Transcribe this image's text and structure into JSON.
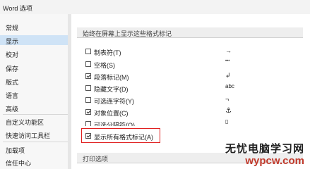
{
  "window": {
    "title": "Word 选项"
  },
  "sidebar": {
    "items": [
      {
        "label": "常规",
        "active": false
      },
      {
        "label": "显示",
        "active": true
      },
      {
        "label": "校对",
        "active": false
      },
      {
        "label": "保存",
        "active": false
      },
      {
        "label": "版式",
        "active": false
      },
      {
        "label": "语言",
        "active": false
      },
      {
        "label": "高级",
        "active": false
      },
      {
        "label": "自定义功能区",
        "active": false
      },
      {
        "label": "快速访问工具栏",
        "active": false
      },
      {
        "label": "加载项",
        "active": false
      },
      {
        "label": "信任中心",
        "active": false
      }
    ]
  },
  "main": {
    "section1_title": "始终在屏幕上显示这些格式标记",
    "options": [
      {
        "label": "制表符(T)",
        "checked": false,
        "symbol": "→"
      },
      {
        "label": "空格(S)",
        "checked": false,
        "symbol": "•••"
      },
      {
        "label": "段落标记(M)",
        "checked": true,
        "symbol": "↲"
      },
      {
        "label": "隐藏文字(D)",
        "checked": false,
        "symbol": "abc"
      },
      {
        "label": "可选连字符(Y)",
        "checked": false,
        "symbol": "¬"
      },
      {
        "label": "对象位置(C)",
        "checked": true,
        "symbol": "⚓"
      },
      {
        "label": "可选分隔符(O)",
        "checked": false,
        "symbol": "▯"
      },
      {
        "label": "显示所有格式标记(A)",
        "checked": true,
        "symbol": ""
      }
    ],
    "section2_title": "打印选项"
  },
  "watermark": {
    "text": "无忧电脑学习网",
    "url": "wypcw.com"
  },
  "colors": {
    "highlight": "#e02020",
    "active_nav": "#cfe3f6"
  }
}
